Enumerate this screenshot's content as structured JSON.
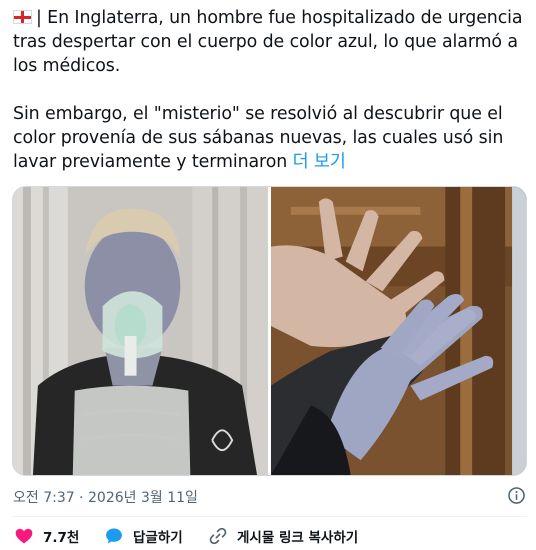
{
  "tweet": {
    "paragraph1": "| En Inglaterra, un hombre fue hospitalizado de urgencia tras despertar con el cuerpo de color azul, lo que alarmó a los médicos.",
    "paragraph2": "Sin embargo, el \"misterio\" se resolvió al descubrir que el color provenía de sus sábanas nuevas, las cuales usó sin lavar previamente y terminaron",
    "show_more": "더 보기",
    "timestamp": "오전 7:37 · 2026년 3월 11일"
  },
  "actions": {
    "likes": "7.7천",
    "reply": "답글하기",
    "copy_link": "게시물 링크 복사하기"
  },
  "colors": {
    "link": "#1d9bf0",
    "like": "#f91880",
    "reply": "#1d9bf0",
    "text": "#0f1419",
    "muted": "#536471"
  },
  "icons": [
    "england-flag-icon",
    "info-icon",
    "heart-icon",
    "reply-bubble-icon",
    "link-icon"
  ]
}
